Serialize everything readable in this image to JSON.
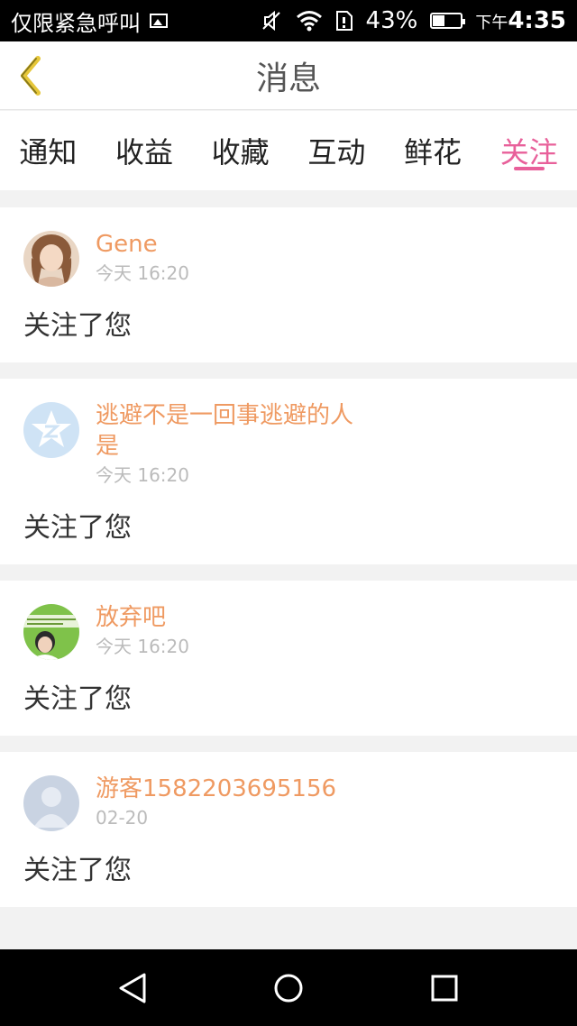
{
  "status_bar": {
    "carrier_text": "仅限紧急呼叫",
    "battery_percent": "43%",
    "time_prefix": "下午",
    "time": "4:35"
  },
  "header": {
    "title": "消息"
  },
  "tabs": [
    {
      "label": "通知",
      "active": false
    },
    {
      "label": "收益",
      "active": false
    },
    {
      "label": "收藏",
      "active": false
    },
    {
      "label": "互动",
      "active": false
    },
    {
      "label": "鲜花",
      "active": false
    },
    {
      "label": "关注",
      "active": true
    }
  ],
  "feed": [
    {
      "name": "Gene",
      "time": "今天 16:20",
      "text": "关注了您"
    },
    {
      "name": "逃避不是一回事逃避的人是",
      "time": "今天 16:20",
      "text": "关注了您"
    },
    {
      "name": "放弃吧",
      "time": "今天 16:20",
      "text": "关注了您"
    },
    {
      "name": "游客1582203695156",
      "time": "02-20",
      "text": "关注了您"
    }
  ],
  "colors": {
    "accent_pink": "#e8609a",
    "name_orange": "#ef9a62"
  }
}
